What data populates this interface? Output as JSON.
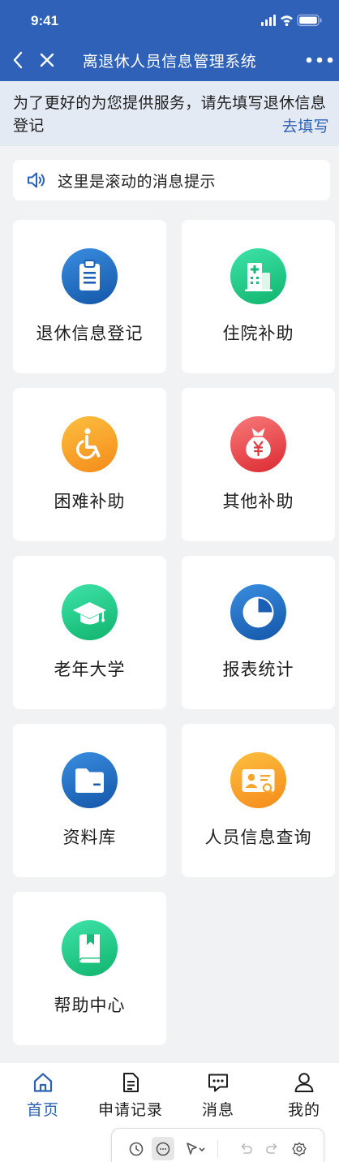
{
  "status_bar": {
    "time": "9:41"
  },
  "nav": {
    "title": "离退休人员信息管理系统"
  },
  "notice": {
    "text": "为了更好的为您提供服务，请先填写退休信息登记",
    "link": "去填写"
  },
  "marquee": {
    "text": "这里是滚动的消息提示",
    "icon": "speaker-icon"
  },
  "grid": [
    {
      "label": "退休信息登记",
      "icon": "clipboard-icon",
      "color": "#1e6cc4"
    },
    {
      "label": "住院补助",
      "icon": "hospital-icon",
      "color": "#1fc985"
    },
    {
      "label": "困难补助",
      "icon": "wheelchair-icon",
      "color": "#f7a42a"
    },
    {
      "label": "其他补助",
      "icon": "money-bag-icon",
      "color": "#e5444a"
    },
    {
      "label": "老年大学",
      "icon": "graduation-cap-icon",
      "color": "#1fc985"
    },
    {
      "label": "报表统计",
      "icon": "pie-chart-icon",
      "color": "#1e6cc4"
    },
    {
      "label": "资料库",
      "icon": "folder-icon",
      "color": "#1e6cc4"
    },
    {
      "label": "人员信息查询",
      "icon": "id-card-search-icon",
      "color": "#f7a42a"
    },
    {
      "label": "帮助中心",
      "icon": "book-icon",
      "color": "#1fc985"
    }
  ],
  "tabbar": [
    {
      "label": "首页",
      "icon": "home-icon",
      "active": true
    },
    {
      "label": "申请记录",
      "icon": "document-icon"
    },
    {
      "label": "消息",
      "icon": "chat-icon"
    },
    {
      "label": "我的",
      "icon": "user-icon"
    }
  ],
  "toolbar": [
    "clock-icon",
    "comment-icon",
    "pointer-icon",
    "undo-icon",
    "redo-icon",
    "settings-icon"
  ],
  "colors": {
    "primary": "#2f61b8",
    "link": "#2d61b6",
    "background": "#f1f2f4"
  }
}
